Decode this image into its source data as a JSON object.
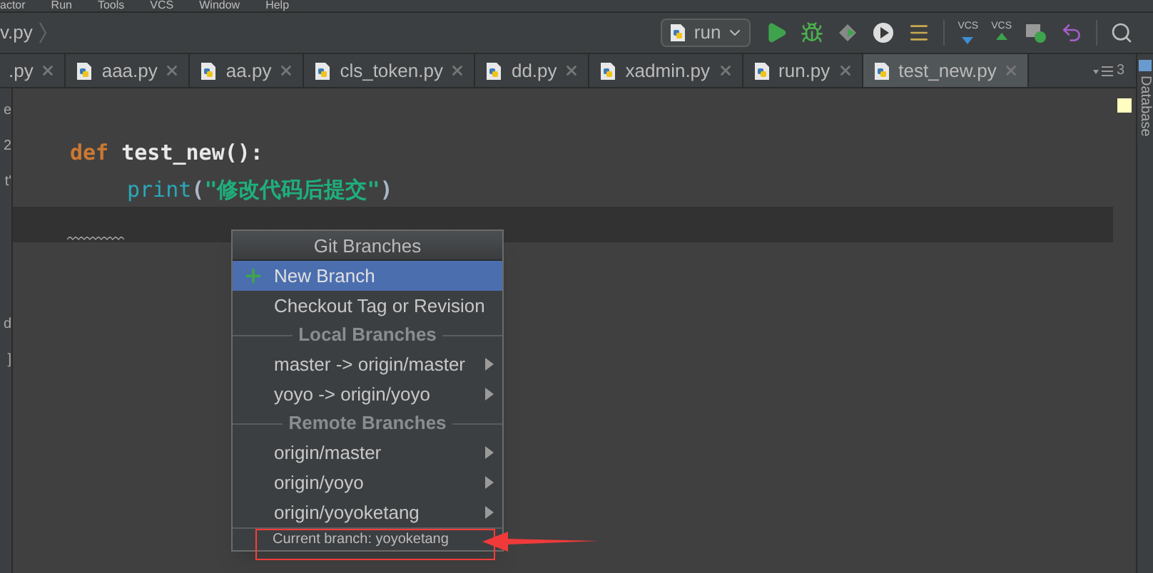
{
  "menu_bar": [
    "actor",
    "Run",
    "Tools",
    "VCS",
    "Window",
    "Help"
  ],
  "breadcrumb": "v.py",
  "run_config": "run",
  "toolbar_vcs_labels": [
    "VCS",
    "VCS"
  ],
  "tabs": [
    {
      "label": ".py",
      "selected": false
    },
    {
      "label": "aaa.py",
      "selected": false
    },
    {
      "label": "aa.py",
      "selected": false
    },
    {
      "label": "cls_token.py",
      "selected": false
    },
    {
      "label": "dd.py",
      "selected": false
    },
    {
      "label": "xadmin.py",
      "selected": false
    },
    {
      "label": "run.py",
      "selected": false
    },
    {
      "label": "test_new.py",
      "selected": true
    }
  ],
  "tab_overflow": "3",
  "left_panel_fragments": [
    "e",
    "2",
    "t'",
    "d",
    "]"
  ],
  "code": {
    "keyword": "def",
    "function": "test_new",
    "signature_tail": "():",
    "call": "print",
    "open_paren": "(",
    "string": "\"修改代码后提交\"",
    "close_paren": ")"
  },
  "right_sidebar": "Database",
  "popup": {
    "title": "Git Branches",
    "items": [
      {
        "kind": "create",
        "label": "New Branch",
        "selected": true
      },
      {
        "kind": "action",
        "label": "Checkout Tag or Revision",
        "selected": false
      },
      {
        "kind": "section",
        "label": "Local Branches"
      },
      {
        "kind": "branch",
        "label": "master -> origin/master",
        "selected": false
      },
      {
        "kind": "branch",
        "label": "yoyo -> origin/yoyo",
        "selected": false
      },
      {
        "kind": "section",
        "label": "Remote Branches"
      },
      {
        "kind": "branch",
        "label": "origin/master",
        "selected": false
      },
      {
        "kind": "branch",
        "label": "origin/yoyo",
        "selected": false
      },
      {
        "kind": "branch",
        "label": "origin/yoyoketang",
        "selected": false
      }
    ],
    "footer": "Current branch: yoyoketang",
    "footer_highlighted": true
  }
}
